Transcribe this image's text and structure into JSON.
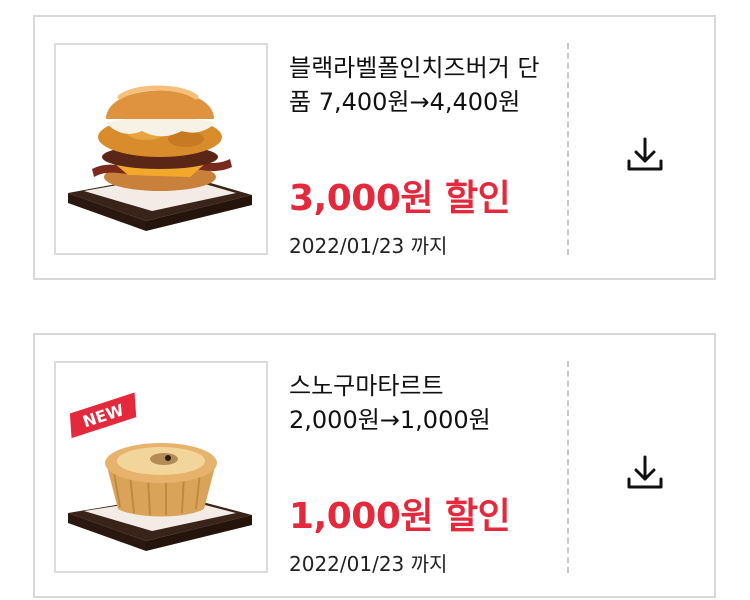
{
  "coupons": [
    {
      "name_line1": "블랙라벨폴인치즈버거 단",
      "name_line2": "품 7,400원→4,400원",
      "discount": "3,000원 할인",
      "expiry": "2022/01/23 까지",
      "image_icon": "burger-image",
      "action_icon": "download-icon"
    },
    {
      "name_line1": "스노구마타르트",
      "name_line2": "2,000원→1,000원",
      "discount": "1,000원 할인",
      "expiry": "2022/01/23 까지",
      "badge": "NEW",
      "image_icon": "tart-image",
      "action_icon": "download-icon"
    }
  ],
  "colors": {
    "discount": "#e5293c",
    "border": "#d8d8d8",
    "badge": "#e5293c"
  }
}
